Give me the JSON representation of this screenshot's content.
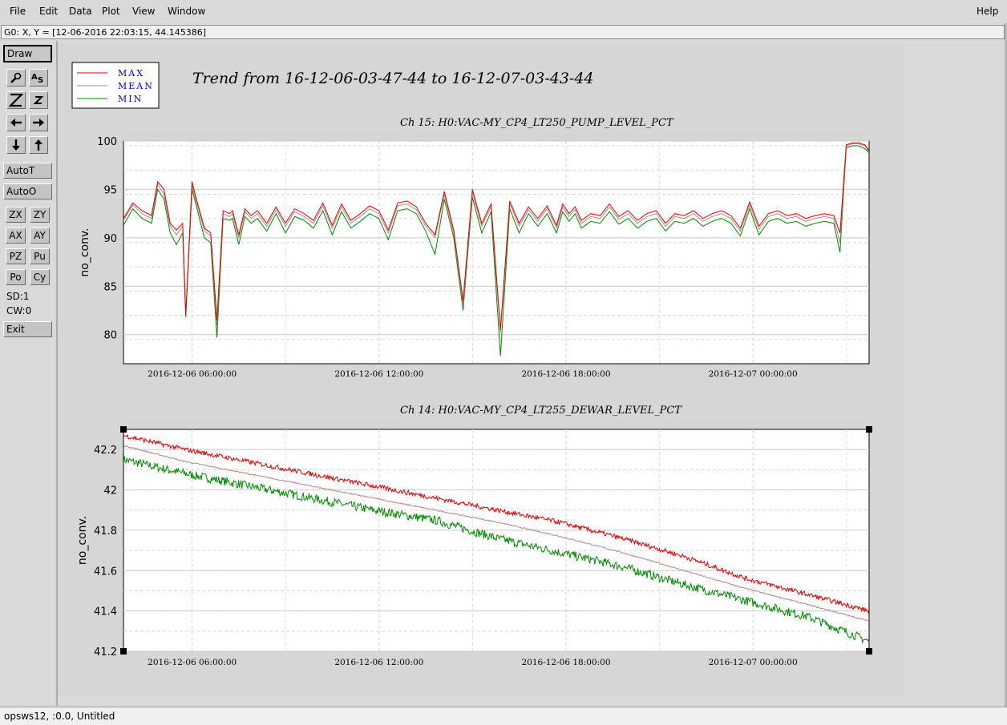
{
  "menu": {
    "file": "File",
    "edit": "Edit",
    "data": "Data",
    "plot": "Plot",
    "view": "View",
    "window": "Window",
    "help": "Help"
  },
  "coord_readout": "G0: X, Y = [12-06-2016 22:03:15, 44.145386]",
  "toolbar": {
    "draw": "Draw",
    "autot": "AutoT",
    "autoo": "AutoO",
    "zx": "ZX",
    "zy": "ZY",
    "ax": "AX",
    "ay": "AY",
    "pz": "PZ",
    "pu": "Pu",
    "po": "Po",
    "cy": "Cy",
    "sd": "SD:1",
    "cw": "CW:0",
    "exit": "Exit",
    "icons": [
      "magnify-icon",
      "as-icon",
      "zoom-big-icon",
      "zoom-small-icon",
      "arrow-left-icon",
      "arrow-right-icon",
      "arrow-down-icon",
      "arrow-up-icon"
    ]
  },
  "legend": {
    "max": "MAX",
    "mean": "MEAN",
    "min": "MIN"
  },
  "colors": {
    "max": "#dd0000",
    "mean": "#b08a8a",
    "min": "#008800",
    "legend_text": "#0000cc"
  },
  "main_title": "Trend from 16-12-06-03-47-44 to 16-12-07-03-43-44",
  "chart_data": [
    {
      "type": "line",
      "title": "Ch 15: H0:VAC-MY_CP4_LT250_PUMP_LEVEL_PCT",
      "ylabel": "no_conv.",
      "xlabel": "",
      "ylim": [
        77,
        100
      ],
      "yticks": [
        "100",
        "95",
        "90",
        "85",
        "80"
      ],
      "xticks": [
        "2016-12-06 06:00:00",
        "2016-12-06 12:00:00",
        "2016-12-06 18:00:00",
        "2016-12-07 00:00:00"
      ],
      "grid": true,
      "x_hours_since_start": [
        0,
        0.3,
        0.6,
        0.9,
        1.1,
        1.3,
        1.5,
        1.7,
        1.9,
        2.0,
        2.2,
        2.3,
        2.4,
        2.6,
        2.8,
        3.0,
        3.2,
        3.4,
        3.5,
        3.7,
        3.9,
        4.1,
        4.3,
        4.6,
        4.9,
        5.2,
        5.5,
        5.8,
        6.1,
        6.4,
        6.7,
        7.0,
        7.3,
        7.6,
        7.9,
        8.2,
        8.5,
        8.8,
        9.1,
        9.4,
        9.7,
        10.0,
        10.3,
        10.6,
        10.9,
        11.2,
        11.5,
        11.8,
        12.1,
        12.4,
        12.7,
        13.0,
        13.3,
        13.6,
        13.9,
        14.1,
        14.3,
        14.5,
        14.7,
        15.0,
        15.3,
        15.6,
        15.9,
        16.2,
        16.5,
        16.8,
        17.1,
        17.4,
        17.7,
        18.0,
        18.3,
        18.6,
        18.9,
        19.2,
        19.5,
        19.8,
        20.1,
        20.4,
        20.7,
        21.0,
        21.3,
        21.6,
        21.9,
        22.2,
        22.5,
        22.8,
        23.0,
        23.2,
        23.4,
        23.6,
        23.8,
        23.93
      ],
      "series": [
        {
          "name": "MAX",
          "values": [
            92,
            93.6,
            92.8,
            92.3,
            95.8,
            95,
            91.5,
            90.8,
            91.5,
            82,
            95.8,
            94.5,
            93.3,
            91,
            90.5,
            81.5,
            92.8,
            92.5,
            92.8,
            90.3,
            93,
            92.3,
            92.8,
            91.5,
            93.2,
            91.5,
            93,
            92.5,
            91.8,
            93.6,
            91.3,
            93.5,
            91.8,
            92.5,
            93.3,
            92.8,
            90.8,
            93.6,
            93.8,
            93.2,
            91.5,
            90.3,
            94.8,
            90.8,
            83.5,
            95,
            91.5,
            93.5,
            80.5,
            93.8,
            91.5,
            93.2,
            92,
            93.3,
            91.3,
            93.5,
            92.5,
            93.2,
            91.8,
            92.5,
            92.3,
            93.5,
            92.2,
            92.8,
            91.8,
            92.5,
            92.8,
            91.5,
            92.5,
            92.3,
            92.8,
            92,
            92.5,
            92.8,
            92.3,
            91,
            93.7,
            91.2,
            92.5,
            92.8,
            92.3,
            92.5,
            92,
            92.3,
            92.5,
            92.3,
            90.5,
            99.6,
            99.8,
            99.8,
            99.6,
            99.0
          ]
        },
        {
          "name": "MEAN",
          "values": [
            91.8,
            93.4,
            92.5,
            92,
            95.5,
            94.5,
            91.2,
            90.3,
            91.2,
            82,
            95.5,
            94.2,
            93,
            90.7,
            90.2,
            81,
            92.5,
            92.2,
            92.5,
            90,
            92.7,
            92,
            92.5,
            91.2,
            92.9,
            91.2,
            92.7,
            92.2,
            91.5,
            93.3,
            91,
            93.2,
            91.5,
            92.2,
            93,
            92.5,
            90.5,
            93.3,
            93.5,
            92.9,
            91.2,
            90,
            94.5,
            90.5,
            83,
            94.7,
            91.2,
            93.2,
            80.2,
            93.5,
            91.2,
            92.9,
            91.7,
            93,
            91,
            93.2,
            92.2,
            92.9,
            91.5,
            92.2,
            92,
            93.2,
            91.9,
            92.5,
            91.5,
            92.2,
            92.5,
            91.2,
            92.2,
            92,
            92.5,
            91.7,
            92.2,
            92.5,
            92,
            90.7,
            93.4,
            90.9,
            92.2,
            92.5,
            92,
            92.2,
            91.7,
            92,
            92.2,
            92,
            89.5,
            99.5,
            99.7,
            99.7,
            99.5,
            98.9
          ]
        },
        {
          "name": "MIN",
          "values": [
            91.3,
            93,
            92,
            91.5,
            95,
            94,
            90.5,
            89.3,
            90.5,
            81.8,
            95,
            93.8,
            92.5,
            90,
            89.5,
            79.7,
            92,
            91.8,
            92,
            89.3,
            92.2,
            91.5,
            92,
            90.7,
            92.5,
            90.5,
            92.2,
            91.8,
            91,
            92.8,
            90.3,
            92.7,
            91,
            91.7,
            92.5,
            92,
            89.8,
            92.8,
            93,
            92.5,
            90.7,
            88.3,
            94,
            90,
            82.5,
            94.2,
            90.5,
            92.7,
            77.8,
            93,
            90.5,
            92.5,
            91.2,
            92.5,
            90.5,
            92.7,
            91.7,
            92.5,
            91,
            91.7,
            91.5,
            92.7,
            91.4,
            92,
            91,
            91.7,
            92,
            90.7,
            91.7,
            91.5,
            92,
            91.2,
            91.7,
            92,
            91.5,
            90.2,
            93,
            90.3,
            91.7,
            92,
            91.5,
            91.7,
            91.2,
            91.5,
            91.7,
            91.5,
            88.5,
            99.3,
            99.5,
            99.5,
            99.2,
            98.8
          ]
        }
      ]
    },
    {
      "type": "line",
      "title": "Ch 14: H0:VAC-MY_CP4_LT255_DEWAR_LEVEL_PCT",
      "ylabel": "no_conv.",
      "xlabel": "",
      "ylim": [
        41.2,
        42.3
      ],
      "yticks": [
        "42.2",
        "42",
        "41.8",
        "41.6",
        "41.4",
        "41.2"
      ],
      "xticks": [
        "2016-12-06 06:00:00",
        "2016-12-06 12:00:00",
        "2016-12-06 18:00:00",
        "2016-12-07 00:00:00"
      ],
      "grid": true,
      "x_hours_since_start": [
        0,
        2,
        4,
        6,
        8,
        10,
        12,
        14,
        16,
        18,
        20,
        22,
        23.93
      ],
      "series": [
        {
          "name": "MAX",
          "values": [
            42.27,
            42.2,
            42.14,
            42.08,
            42.02,
            41.96,
            41.9,
            41.84,
            41.76,
            41.67,
            41.56,
            41.48,
            41.4
          ]
        },
        {
          "name": "MEAN",
          "values": [
            42.22,
            42.14,
            42.08,
            42.02,
            41.96,
            41.9,
            41.84,
            41.77,
            41.69,
            41.6,
            41.51,
            41.43,
            41.35
          ]
        },
        {
          "name": "MIN",
          "values": [
            42.15,
            42.08,
            42.02,
            41.96,
            41.9,
            41.85,
            41.76,
            41.69,
            41.62,
            41.53,
            41.45,
            41.37,
            41.25
          ]
        }
      ]
    }
  ],
  "status_bar": "opsws12, :0.0, Untitled"
}
